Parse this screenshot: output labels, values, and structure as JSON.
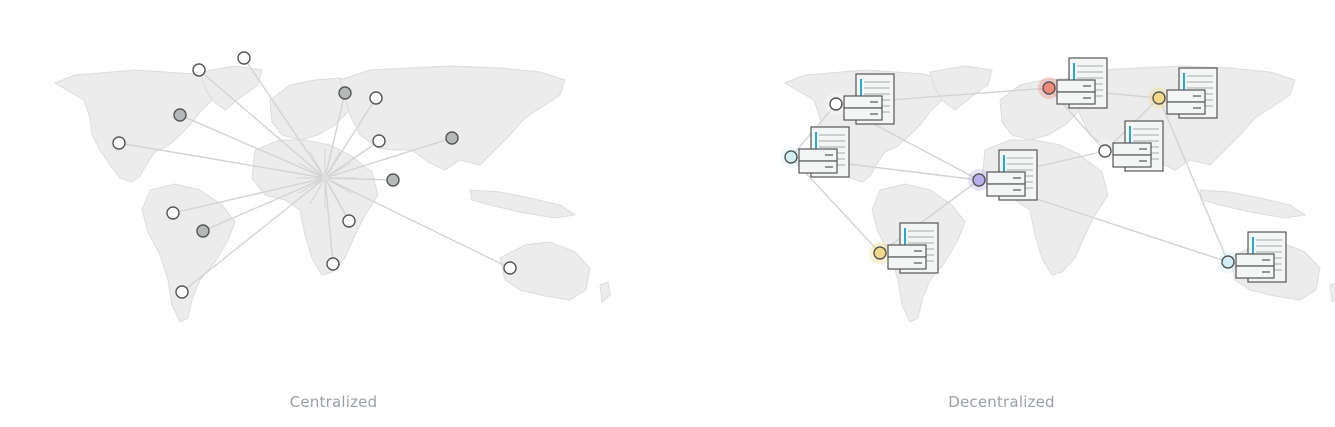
{
  "captions": {
    "left": "Centralized",
    "right": "Decentralized"
  },
  "colors": {
    "land": "#ececec",
    "land_stroke": "#dcdcdc",
    "link": "#d3d3d3",
    "node_stroke": "#555555",
    "node_white": "#ffffff",
    "node_grey": "#b5b8b8",
    "node_red": "#ef8a7a",
    "node_yellow": "#f5d98a",
    "node_blue": "#d2eef5",
    "node_purple": "#b9b0ea",
    "server_fill": "#f4f5f5",
    "server_stroke": "#555555",
    "server_accent": "#29a9cf"
  },
  "icons": {
    "node": "circle-node-icon",
    "server": "server-database-icon",
    "hub": "central-hub-icon"
  }
}
